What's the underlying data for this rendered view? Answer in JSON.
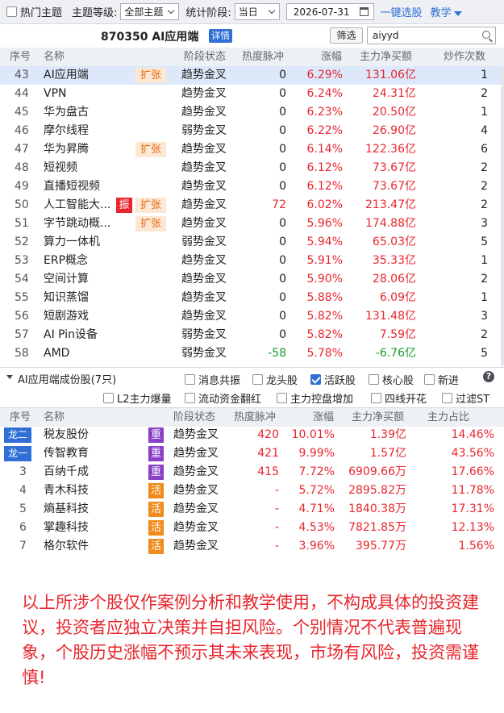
{
  "toolbar": {
    "hot_topic_label": "热门主题",
    "level_label": "主题等级:",
    "level_value": "全部主题",
    "period_label": "统计阶段:",
    "period_value": "当日",
    "date_value": "2026-07-31",
    "one_click_label": "一键选股",
    "teach_label": "教学"
  },
  "header": {
    "title": "870350 AI应用端",
    "detail_label": "详情",
    "filter_label": "筛选",
    "search_value": "aiyyd"
  },
  "topics": {
    "columns": [
      "序号",
      "名称",
      "阶段状态",
      "热度脉冲",
      "涨幅",
      "主力净买额",
      "炒作次数"
    ],
    "rows": [
      {
        "no": "43",
        "name": "AI应用端",
        "tag": "扩张",
        "zhen": "",
        "status": "趋势金叉",
        "heat": "0",
        "change": "6.29%",
        "net": "131.06亿",
        "net_sign": "pos",
        "count": "1",
        "selected": true
      },
      {
        "no": "44",
        "name": "VPN",
        "tag": "",
        "zhen": "",
        "status": "趋势金叉",
        "heat": "0",
        "change": "6.24%",
        "net": "24.31亿",
        "net_sign": "pos",
        "count": "2"
      },
      {
        "no": "45",
        "name": "华为盘古",
        "tag": "",
        "zhen": "",
        "status": "趋势金叉",
        "heat": "0",
        "change": "6.23%",
        "net": "20.50亿",
        "net_sign": "pos",
        "count": "1"
      },
      {
        "no": "46",
        "name": "摩尔线程",
        "tag": "",
        "zhen": "",
        "status": "弱势金叉",
        "heat": "0",
        "change": "6.22%",
        "net": "26.90亿",
        "net_sign": "pos",
        "count": "4"
      },
      {
        "no": "47",
        "name": "华为昇腾",
        "tag": "扩张",
        "zhen": "",
        "status": "趋势金叉",
        "heat": "0",
        "change": "6.14%",
        "net": "122.36亿",
        "net_sign": "pos",
        "count": "6"
      },
      {
        "no": "48",
        "name": "短视频",
        "tag": "",
        "zhen": "",
        "status": "趋势金叉",
        "heat": "0",
        "change": "6.12%",
        "net": "73.67亿",
        "net_sign": "pos",
        "count": "2"
      },
      {
        "no": "49",
        "name": "直播短视频",
        "tag": "",
        "zhen": "",
        "status": "趋势金叉",
        "heat": "0",
        "change": "6.12%",
        "net": "73.67亿",
        "net_sign": "pos",
        "count": "2"
      },
      {
        "no": "50",
        "name": "人工智能大...",
        "tag": "扩张",
        "zhen": "振",
        "status": "趋势金叉",
        "heat": "72",
        "heat_red": true,
        "change": "6.02%",
        "net": "213.47亿",
        "net_sign": "pos",
        "count": "2"
      },
      {
        "no": "51",
        "name": "字节跳动概...",
        "tag": "扩张",
        "zhen": "",
        "status": "趋势金叉",
        "heat": "0",
        "change": "5.96%",
        "net": "174.88亿",
        "net_sign": "pos",
        "count": "3"
      },
      {
        "no": "52",
        "name": "算力一体机",
        "tag": "",
        "zhen": "",
        "status": "弱势金叉",
        "heat": "0",
        "change": "5.94%",
        "net": "65.03亿",
        "net_sign": "pos",
        "count": "5"
      },
      {
        "no": "53",
        "name": "ERP概念",
        "tag": "",
        "zhen": "",
        "status": "趋势金叉",
        "heat": "0",
        "change": "5.91%",
        "net": "35.33亿",
        "net_sign": "pos",
        "count": "1"
      },
      {
        "no": "54",
        "name": "空间计算",
        "tag": "",
        "zhen": "",
        "status": "趋势金叉",
        "heat": "0",
        "change": "5.90%",
        "net": "28.06亿",
        "net_sign": "pos",
        "count": "2"
      },
      {
        "no": "55",
        "name": "知识蒸馏",
        "tag": "",
        "zhen": "",
        "status": "趋势金叉",
        "heat": "0",
        "change": "5.88%",
        "net": "6.09亿",
        "net_sign": "pos",
        "count": "1"
      },
      {
        "no": "56",
        "name": "短剧游戏",
        "tag": "",
        "zhen": "",
        "status": "趋势金叉",
        "heat": "0",
        "change": "5.82%",
        "net": "131.48亿",
        "net_sign": "pos",
        "count": "3"
      },
      {
        "no": "57",
        "name": "AI Pin设备",
        "tag": "",
        "zhen": "",
        "status": "弱势金叉",
        "heat": "0",
        "change": "5.82%",
        "net": "7.59亿",
        "net_sign": "pos",
        "count": "2"
      },
      {
        "no": "58",
        "name": "AMD",
        "tag": "",
        "zhen": "",
        "status": "弱势金叉",
        "heat": "-58",
        "heat_green": true,
        "change": "5.78%",
        "net": "-6.76亿",
        "net_sign": "neg",
        "count": "5"
      }
    ]
  },
  "stocks_panel": {
    "title": "AI应用端成份股(7只)",
    "options_row1": [
      {
        "label": "消息共振",
        "checked": false
      },
      {
        "label": "龙头股",
        "checked": false
      },
      {
        "label": "活跃股",
        "checked": true
      },
      {
        "label": "核心股",
        "checked": false
      },
      {
        "label": "新进",
        "checked": false
      }
    ],
    "options_row2": [
      {
        "label": "L2主力爆量",
        "checked": false
      },
      {
        "label": "流动资金翻红",
        "checked": false
      },
      {
        "label": "主力控盘增加",
        "checked": false
      },
      {
        "label": "四线开花",
        "checked": false
      },
      {
        "label": "过滤ST",
        "checked": false
      }
    ],
    "help_label": "?"
  },
  "stocks": {
    "columns": [
      "序号",
      "名称",
      "阶段状态",
      "热度脉冲",
      "涨幅",
      "主力净买额",
      "主力占比"
    ],
    "rows": [
      {
        "no": "龙二",
        "dragon": true,
        "name": "税友股份",
        "badge": "重",
        "badge_type": "zhong",
        "status": "趋势金叉",
        "heat": "420",
        "change": "10.01%",
        "net": "1.39亿",
        "ratio": "14.46%"
      },
      {
        "no": "龙一",
        "dragon": true,
        "name": "传智教育",
        "badge": "重",
        "badge_type": "zhong",
        "status": "趋势金叉",
        "heat": "421",
        "change": "9.99%",
        "net": "1.57亿",
        "ratio": "43.56%"
      },
      {
        "no": "3",
        "dragon": false,
        "name": "百纳千成",
        "badge": "重",
        "badge_type": "zhong",
        "status": "趋势金叉",
        "heat": "415",
        "change": "7.72%",
        "net": "6909.66万",
        "ratio": "17.66%"
      },
      {
        "no": "4",
        "dragon": false,
        "name": "青木科技",
        "badge": "活",
        "badge_type": "huo",
        "status": "趋势金叉",
        "heat": "-",
        "change": "5.72%",
        "net": "2895.82万",
        "ratio": "11.78%"
      },
      {
        "no": "5",
        "dragon": false,
        "name": "熵基科技",
        "badge": "活",
        "badge_type": "huo",
        "status": "趋势金叉",
        "heat": "-",
        "change": "4.71%",
        "net": "1840.38万",
        "ratio": "17.31%"
      },
      {
        "no": "6",
        "dragon": false,
        "name": "掌趣科技",
        "badge": "活",
        "badge_type": "huo",
        "status": "趋势金叉",
        "heat": "-",
        "change": "4.53%",
        "net": "7821.85万",
        "ratio": "12.13%"
      },
      {
        "no": "7",
        "dragon": false,
        "name": "格尔软件",
        "badge": "活",
        "badge_type": "huo",
        "status": "趋势金叉",
        "heat": "-",
        "change": "3.96%",
        "net": "395.77万",
        "ratio": "1.56%"
      }
    ]
  },
  "disclaimer": "以上所涉个股仅作案例分析和教学使用，不构成具体的投资建议，投资者应独立决策并自担风险。个别情况不代表普遍现象，个股历史涨幅不预示其未来表现，市场有风险，投资需谨慎!",
  "colors": {
    "accent": "#2f6fd6",
    "up": "#e8262d",
    "down": "#1a9a2a",
    "expand_bg": "#fde8d4",
    "expand_fg": "#e86a12"
  }
}
